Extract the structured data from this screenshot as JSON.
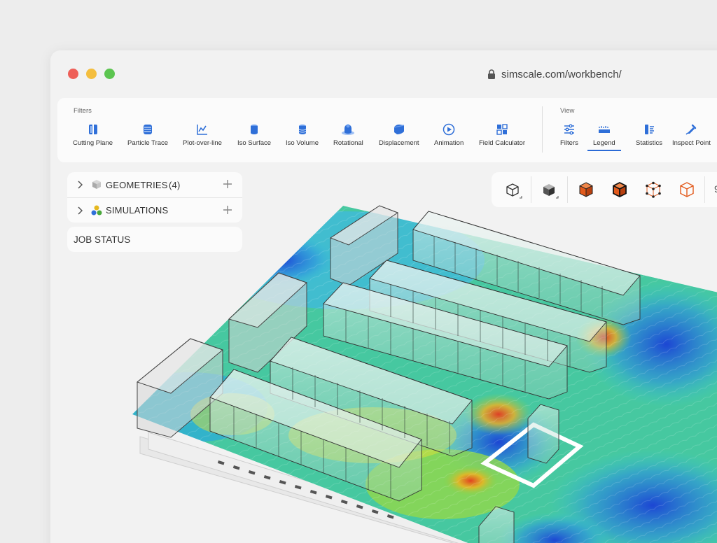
{
  "window": {
    "url": "simscale.com/workbench/"
  },
  "ribbon": {
    "filters_label": "Filters",
    "view_label": "View",
    "filters": [
      {
        "label": "Cutting Plane",
        "icon": "cutting-plane-icon"
      },
      {
        "label": "Particle Trace",
        "icon": "particle-trace-icon"
      },
      {
        "label": "Plot-over-line",
        "icon": "plot-over-line-icon"
      },
      {
        "label": "Iso Surface",
        "icon": "iso-surface-icon"
      },
      {
        "label": "Iso Volume",
        "icon": "iso-volume-icon"
      },
      {
        "label": "Rotational",
        "icon": "rotational-icon"
      },
      {
        "label": "Displacement",
        "icon": "displacement-icon"
      },
      {
        "label": "Animation",
        "icon": "animation-icon"
      },
      {
        "label": "Field Calculator",
        "icon": "field-calculator-icon"
      }
    ],
    "view": [
      {
        "label": "Filters",
        "icon": "filters-sliders-icon"
      },
      {
        "label": "Legend",
        "icon": "legend-icon",
        "active": true
      },
      {
        "label": "Statistics",
        "icon": "statistics-icon"
      },
      {
        "label": "Inspect Point",
        "icon": "inspect-point-icon"
      }
    ]
  },
  "tree": {
    "geometries_label": "GEOMETRIES",
    "geometries_count": "(4)",
    "simulations_label": "SIMULATIONS"
  },
  "job_status_label": "JOB STATUS",
  "viewbar": {
    "buttons": [
      "wireframe-cube-icon",
      "solid-cube-icon",
      "orange-solid-cube-icon",
      "orange-edges-cube-icon",
      "vertices-cube-icon",
      "orange-outline-cube-icon"
    ],
    "trailing_text": "9"
  },
  "colors": {
    "accent": "#2a6ad6",
    "filter_icon": "#2f6fd8",
    "highlight_orange": "#e25a1c"
  }
}
